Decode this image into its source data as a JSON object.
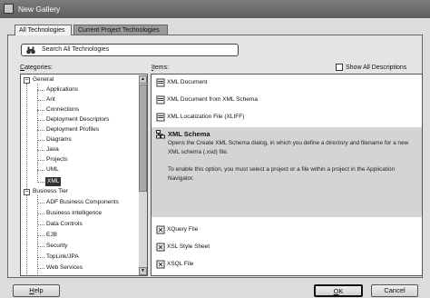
{
  "window": {
    "title": "New Gallery"
  },
  "tabs": [
    {
      "label": "All Technologies",
      "active": true
    },
    {
      "label": "Current Project Technologies",
      "active": false
    }
  ],
  "search": {
    "placeholder": "Search All Technologies",
    "icon": "binoculars-icon"
  },
  "categories": {
    "label": "Categories:",
    "groups": [
      {
        "label": "General",
        "expanded": true,
        "children": [
          "Applications",
          "Ant",
          "Connections",
          "Deployment Descriptors",
          "Deployment Profiles",
          "Diagrams",
          "Java",
          "Projects",
          "UML",
          "XML"
        ]
      },
      {
        "label": "Business Tier",
        "expanded": true,
        "children": [
          "ADF Business Components",
          "Business Intelligence",
          "Data Controls",
          "EJB",
          "Security",
          "TopLink/JPA",
          "Web Services"
        ]
      }
    ],
    "selected": "XML"
  },
  "items": {
    "label": "Items:",
    "show_all_label": "Show All Descriptions",
    "show_all_checked": false,
    "entries": [
      {
        "label": "XML Document",
        "icon": "xml-document-icon"
      },
      {
        "label": "XML Document from XML Schema",
        "icon": "xml-document-icon"
      },
      {
        "label": "XML Localization File (XLIFF)",
        "icon": "xml-document-icon"
      },
      {
        "label": "XML Schema",
        "icon": "xml-schema-icon",
        "selected": true,
        "description": "Opens the Create XML Schema dialog, in which you define a directory and filename for a new XML schema (.xsd) file.",
        "note": "To enable this option, you must select a project or a file within a project in the Application Navigator."
      },
      {
        "label": "XQuery File",
        "icon": "xquery-file-icon"
      },
      {
        "label": "XSL Style Sheet",
        "icon": "xsl-stylesheet-icon"
      },
      {
        "label": "XSQL File",
        "icon": "xsql-file-icon"
      }
    ]
  },
  "buttons": {
    "help": "Help",
    "ok": "OK",
    "cancel": "Cancel"
  }
}
